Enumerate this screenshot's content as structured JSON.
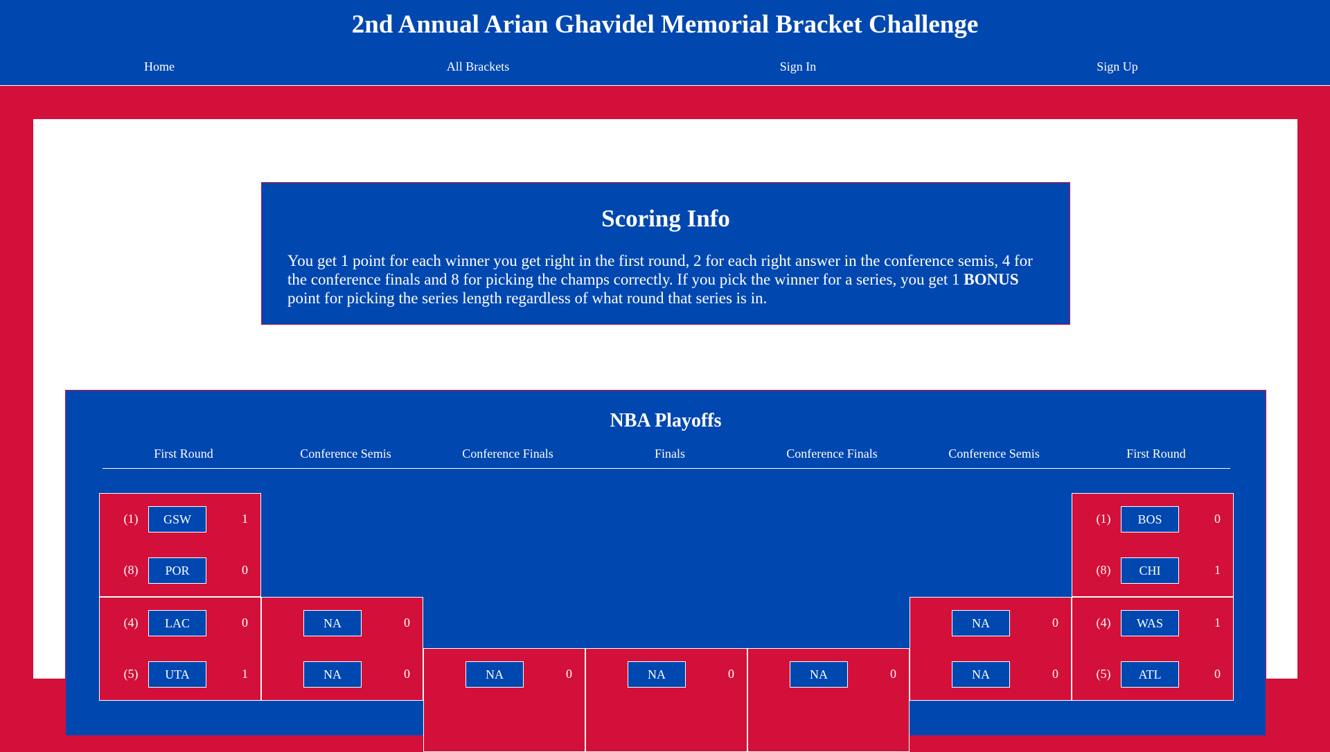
{
  "site": {
    "title": "2nd Annual Arian Ghavidel Memorial Bracket Challenge",
    "nav": [
      "Home",
      "All Brackets",
      "Sign In",
      "Sign Up"
    ]
  },
  "scoring": {
    "heading": "Scoring Info",
    "text_before": "You get 1 point for each winner you get right in the first round, 2 for each right answer in the conference semis, 4 for the conference finals and 8 for picking the champs correctly. If you pick the winner for a series, you get 1 ",
    "bonus": "BONUS",
    "text_after": " point for picking the series length regardless of what round that series is in."
  },
  "bracket": {
    "heading": "NBA Playoffs",
    "rounds": [
      "First Round",
      "Conference Semis",
      "Conference Finals",
      "Finals",
      "Conference Finals",
      "Conference Semis",
      "First Round"
    ],
    "west_first_round": [
      {
        "seed": "(1)",
        "team": "GSW",
        "score": "1"
      },
      {
        "seed": "(8)",
        "team": "POR",
        "score": "0"
      },
      {
        "seed": "(4)",
        "team": "LAC",
        "score": "0"
      },
      {
        "seed": "(5)",
        "team": "UTA",
        "score": "1"
      }
    ],
    "east_first_round": [
      {
        "seed": "(1)",
        "team": "BOS",
        "score": "0"
      },
      {
        "seed": "(8)",
        "team": "CHI",
        "score": "1"
      },
      {
        "seed": "(4)",
        "team": "WAS",
        "score": "1"
      },
      {
        "seed": "(5)",
        "team": "ATL",
        "score": "0"
      }
    ],
    "west_semis": [
      {
        "team": "NA",
        "score": "0"
      },
      {
        "team": "NA",
        "score": "0"
      }
    ],
    "east_semis": [
      {
        "team": "NA",
        "score": "0"
      },
      {
        "team": "NA",
        "score": "0"
      }
    ],
    "west_finals": [
      {
        "team": "NA",
        "score": "0"
      }
    ],
    "finals": [
      {
        "team": "NA",
        "score": "0"
      }
    ],
    "east_finals": [
      {
        "team": "NA",
        "score": "0"
      }
    ]
  }
}
